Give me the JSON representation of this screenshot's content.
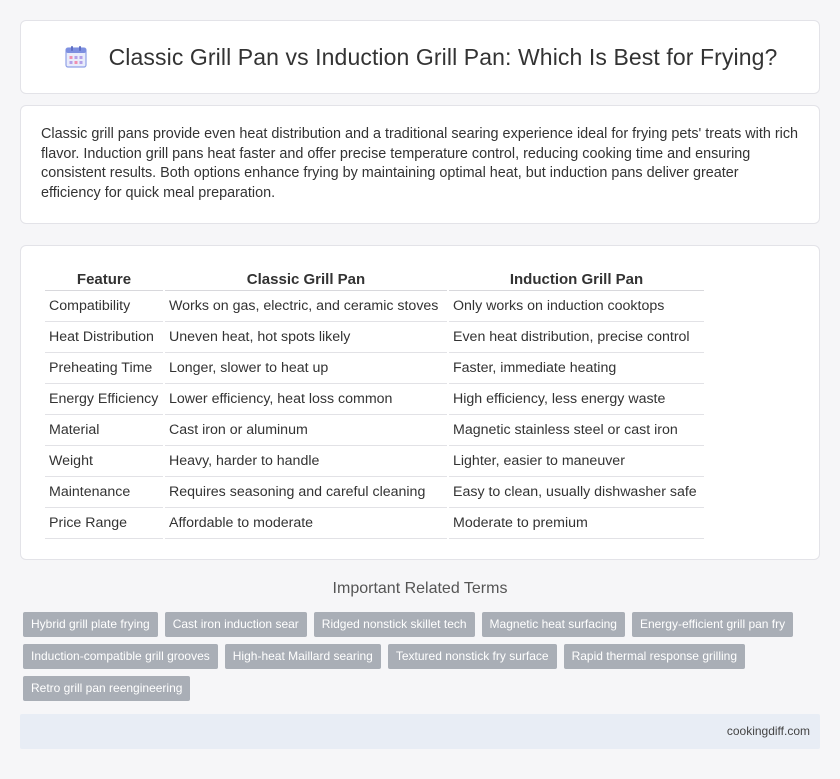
{
  "header": {
    "title": "Classic Grill Pan vs Induction Grill Pan: Which Is Best for Frying?",
    "icon": "calendar-document-icon"
  },
  "intro": {
    "text": "Classic grill pans provide even heat distribution and a traditional searing experience ideal for frying pets' treats with rich flavor. Induction grill pans heat faster and offer precise temperature control, reducing cooking time and ensuring consistent results. Both options enhance frying by maintaining optimal heat, but induction pans deliver greater efficiency for quick meal preparation."
  },
  "table": {
    "headers": [
      "Feature",
      "Classic Grill Pan",
      "Induction Grill Pan"
    ],
    "rows": [
      [
        "Compatibility",
        "Works on gas, electric, and ceramic stoves",
        "Only works on induction cooktops"
      ],
      [
        "Heat Distribution",
        "Uneven heat, hot spots likely",
        "Even heat distribution, precise control"
      ],
      [
        "Preheating Time",
        "Longer, slower to heat up",
        "Faster, immediate heating"
      ],
      [
        "Energy Efficiency",
        "Lower efficiency, heat loss common",
        "High efficiency, less energy waste"
      ],
      [
        "Material",
        "Cast iron or aluminum",
        "Magnetic stainless steel or cast iron"
      ],
      [
        "Weight",
        "Heavy, harder to handle",
        "Lighter, easier to maneuver"
      ],
      [
        "Maintenance",
        "Requires seasoning and careful cleaning",
        "Easy to clean, usually dishwasher safe"
      ],
      [
        "Price Range",
        "Affordable to moderate",
        "Moderate to premium"
      ]
    ]
  },
  "related": {
    "title": "Important Related Terms",
    "tags": [
      "Hybrid grill plate frying",
      "Cast iron induction sear",
      "Ridged nonstick skillet tech",
      "Magnetic heat surfacing",
      "Energy-efficient grill pan fry",
      "Induction-compatible grill grooves",
      "High-heat Maillard searing",
      "Textured nonstick fry surface",
      "Rapid thermal response grilling",
      "Retro grill pan reengineering"
    ]
  },
  "footer": {
    "site": "cookingdiff.com"
  },
  "colors": {
    "tag_bg": "#a9aeb6",
    "footer_bg": "#e8edf5",
    "icon_accent": "#6c7fd8"
  }
}
